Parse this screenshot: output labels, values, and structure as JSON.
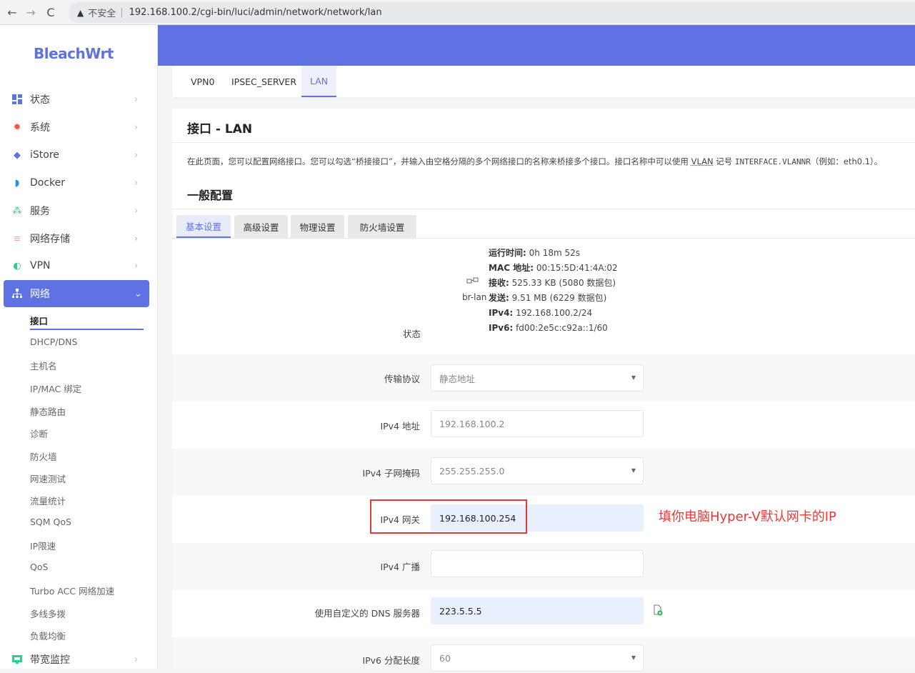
{
  "browser": {
    "insecure_label": "不安全",
    "url": "192.168.100.2/cgi-bin/luci/admin/network/network/lan"
  },
  "sidebar": {
    "brand": "BleachWrt",
    "items": [
      {
        "label": "状态",
        "icon": "dashboard-icon"
      },
      {
        "label": "系统",
        "icon": "gear-icon"
      },
      {
        "label": "iStore",
        "icon": "cube-icon"
      },
      {
        "label": "Docker",
        "icon": "docker-icon"
      },
      {
        "label": "服务",
        "icon": "services-icon"
      },
      {
        "label": "网络存储",
        "icon": "storage-icon"
      },
      {
        "label": "VPN",
        "icon": "vpn-icon"
      },
      {
        "label": "网络",
        "icon": "network-icon"
      },
      {
        "label": "带宽监控",
        "icon": "monitor-icon"
      }
    ],
    "network_submenu": [
      "接口",
      "DHCP/DNS",
      "主机名",
      "IP/MAC 绑定",
      "静态路由",
      "诊断",
      "防火墙",
      "网速测试",
      "流量统计",
      "SQM QoS",
      "IP限速",
      "QoS",
      "Turbo ACC 网络加速",
      "多线多拨",
      "负载均衡"
    ]
  },
  "interface_tabs": [
    "VPN0",
    "IPSEC_SERVER",
    "LAN"
  ],
  "page": {
    "title": "接口 - LAN",
    "desc_pre": "在此页面，您可以配置网络接口。您可以勾选“桥接接口”，并输入由空格分隔的多个网络接口的名称来桥接多个接口。接口名称中可以使用 ",
    "desc_vlan": "VLAN",
    "desc_mid": " 记号 ",
    "desc_code": "INTERFACE.VLANNR",
    "desc_post": "（例如：eth0.1）。",
    "section_title": "一般配置",
    "subtabs": [
      "基本设置",
      "高级设置",
      "物理设置",
      "防火墙设置"
    ]
  },
  "status": {
    "label": "状态",
    "device": "br-lan",
    "uptime_key": "运行时间:",
    "uptime": "0h 18m 52s",
    "mac_key": "MAC 地址:",
    "mac": "00:15:5D:41:4A:02",
    "rx_key": "接收:",
    "rx": "525.33 KB (5080 数据包)",
    "tx_key": "发送:",
    "tx": "9.51 MB (6229 数据包)",
    "ipv4_key": "IPv4:",
    "ipv4": "192.168.100.2/24",
    "ipv6_key": "IPv6:",
    "ipv6": "fd00:2e5c:c92a::1/60"
  },
  "form": {
    "protocol_label": "传输协议",
    "protocol_value": "静态地址",
    "ipv4_addr_label": "IPv4 地址",
    "ipv4_addr_value": "192.168.100.2",
    "netmask_label": "IPv4 子网掩码",
    "netmask_value": "255.255.255.0",
    "gateway_label": "IPv4 网关",
    "gateway_value": "192.168.100.254",
    "broadcast_label": "IPv4 广播",
    "broadcast_value": "",
    "dns_label": "使用自定义的 DNS 服务器",
    "dns_value": "223.5.5.5",
    "ipv6_assign_label": "IPv6 分配长度",
    "ipv6_assign_value": "60"
  },
  "annotation": "填你电脑Hyper-V默认网卡的IP",
  "colors": {
    "accent": "#5e72e4",
    "annotation_red": "#e53935",
    "filled_field": "#e8f0fe"
  }
}
